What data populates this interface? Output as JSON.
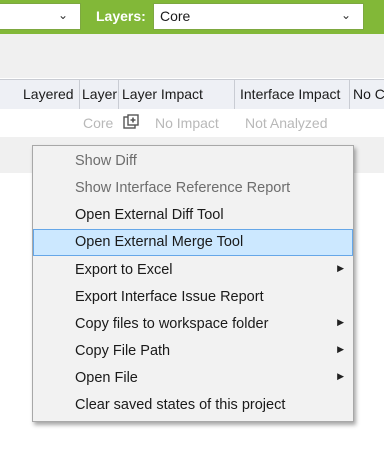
{
  "toolbar": {
    "layers_label": "Layers:",
    "layers_value": "Core",
    "chevron": "⌄"
  },
  "grid": {
    "columns": [
      "Layered",
      "Layer",
      "Layer Impact",
      "Interface Impact",
      "No C"
    ],
    "row": {
      "layer": "Core",
      "layer_impact": "No Impact",
      "interface_impact": "Not Analyzed"
    }
  },
  "context_menu": {
    "items": [
      {
        "label": "Show Diff",
        "disabled": true,
        "submenu": false
      },
      {
        "label": "Show Interface Reference Report",
        "disabled": true,
        "submenu": false
      },
      {
        "label": "Open External Diff Tool",
        "disabled": false,
        "submenu": false
      },
      {
        "label": "Open External Merge Tool",
        "disabled": false,
        "submenu": false,
        "highlighted": true
      },
      {
        "label": "Export to Excel",
        "disabled": false,
        "submenu": true
      },
      {
        "label": "Export Interface Issue Report",
        "disabled": false,
        "submenu": false
      },
      {
        "label": "Copy files to workspace folder",
        "disabled": false,
        "submenu": true
      },
      {
        "label": "Copy File Path",
        "disabled": false,
        "submenu": true
      },
      {
        "label": "Open File",
        "disabled": false,
        "submenu": true
      },
      {
        "label": "Clear saved states of this project",
        "disabled": false,
        "submenu": false
      }
    ],
    "submenu_arrow": "▶"
  },
  "colors": {
    "toolbar_green": "#82b838",
    "highlight": "#cce8ff",
    "highlight_border": "#66a7e8"
  }
}
